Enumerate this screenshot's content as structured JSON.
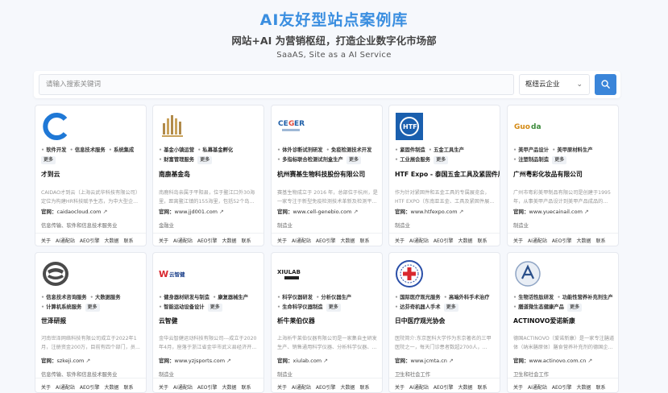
{
  "header": {
    "title": "AI友好型站点案例库",
    "subtitle": "网站+AI 为营销枢纽，打造企业数字化市场部",
    "tagline": "SaaAS, Site as a AI Service"
  },
  "search": {
    "placeholder": "请输入搜索关键词",
    "select_value": "枢纽云企业",
    "button_icon": "search-icon"
  },
  "card_common": {
    "site_label": "官网：",
    "more_label": "更多",
    "footer_links": [
      "关于",
      "AI通配站",
      "AEO引擎",
      "大数据",
      "联系"
    ]
  },
  "cards": [
    {
      "logo": "caidao-logo",
      "tags": [
        "软件开发",
        "信息技术服务",
        "系统集成"
      ],
      "name": "才到云",
      "desc": [
        "CAIDAO才到云（上海云武华科技有限公司）",
        "定位为构建HR科技赋予生态，为中大型企..."
      ],
      "site": "caidaocloud.com",
      "industry": "信息传输、软件和信息技术服务业"
    },
    {
      "logo": "nanyao-logo",
      "tags": [
        "基金小镇运营",
        "私募基金孵化",
        "财富管理服务"
      ],
      "name": "南鹿基金岛",
      "desc": [
        "南鹿科岛亲属于平阳县，位于鳌江口外30海",
        "里，距离鳌江镇的155海里，包括52个岛..."
      ],
      "site": "www.jjd001.com",
      "industry": "金融业"
    },
    {
      "logo": "cengen-logo",
      "tags": [
        "体外诊断试剂研发",
        "免疫检测技术开发",
        "多指标联合检测试剂盒生产"
      ],
      "name": "杭州赛基生物科技股份有限公司",
      "desc": [
        "赛基生物成立于 2016 年，总部位于杭州，是",
        "一家专注于新型免疫检测技术革新及检测平..."
      ],
      "site": "www.cell-genebio.com",
      "industry": "制造业"
    },
    {
      "logo": "htf-logo",
      "tags": [
        "紧固件制造",
        "五金工具生产",
        "工业展会服务"
      ],
      "name": "HTF Expo - 泰国五金工具及紧固件展",
      "desc": [
        "作为针对紧固件和五金工具的专属展览会，",
        "HTF EXPO（东南亚五金、工具及紧固件展..."
      ],
      "site": "www.htfexpo.com",
      "industry": "制造业"
    },
    {
      "logo": "guoda-logo",
      "tags": [
        "美甲产品设计",
        "美甲原材料生产",
        "注塑制品制造"
      ],
      "name": "广州粤彩化妆品有限公司",
      "desc": [
        "广州市粤彩美甲制品有限公司是创建于1995",
        "年，从事美甲产品设计到美甲产品成品的..."
      ],
      "site": "www.yuecainail.com",
      "industry": "制造业"
    },
    {
      "logo": "shijie-logo",
      "tags": [
        "信息技术咨询服务",
        "大数据服务",
        "计算机系统服务"
      ],
      "name": "世泽研报",
      "desc": [
        "河南世泽网络科技有限公司成立于2022年1",
        "月，注册资金200万，目前有四个部门，员..."
      ],
      "site": "szkeji.com",
      "industry": "信息传输、软件和信息技术服务业"
    },
    {
      "logo": "yunzhi-logo",
      "tags": [
        "健身器材研发与制造",
        "康复器械生产",
        "智能运动设备设计"
      ],
      "name": "云智健",
      "desc": [
        "金华云智健运动科技有限公司---成立于2020",
        "年4月，座落于浙江省金华市武义县经济开..."
      ],
      "site": "www.yzjsports.com",
      "industry": "制造业"
    },
    {
      "logo": "xiulab-logo",
      "tags": [
        "科学仪器研发",
        "分析仪器生产",
        "生命科学仪器制造"
      ],
      "name": "析牛莱伯仪器",
      "desc": [
        "上海析牛莱伯仪器有限公司是一家集自主研发",
        "生产、销售通用科学仪器、分析科学仪器、..."
      ],
      "site": "xiulab.com",
      "industry": "制造业"
    },
    {
      "logo": "jcmta-logo",
      "tags": [
        "国际医疗观光服务",
        "高端外科手术治疗",
        "达芬奇机器人手术"
      ],
      "name": "日中医疗观光协会",
      "desc": [
        "医院简介:东京医科大学作为东京著名的三甲",
        "医院之一，每天门诊患者数超2700人，..."
      ],
      "site": "www.jcmta.cn",
      "industry": "卫生和社会工作"
    },
    {
      "logo": "actinovo-logo",
      "tags": [
        "生物活性肽研发",
        "功能性营养补充剂生产",
        "膳道微生态健康产品"
      ],
      "name": "ACTINOVO爱诺新康",
      "desc": [
        "德国ACTINOVO（爱诺新康）是一家专注膳道",
        "体（纳米膳原体）膳食营养补充剂的德国企..."
      ],
      "site": "www.actinovo.com.cn",
      "industry": "卫生和社会工作"
    }
  ]
}
